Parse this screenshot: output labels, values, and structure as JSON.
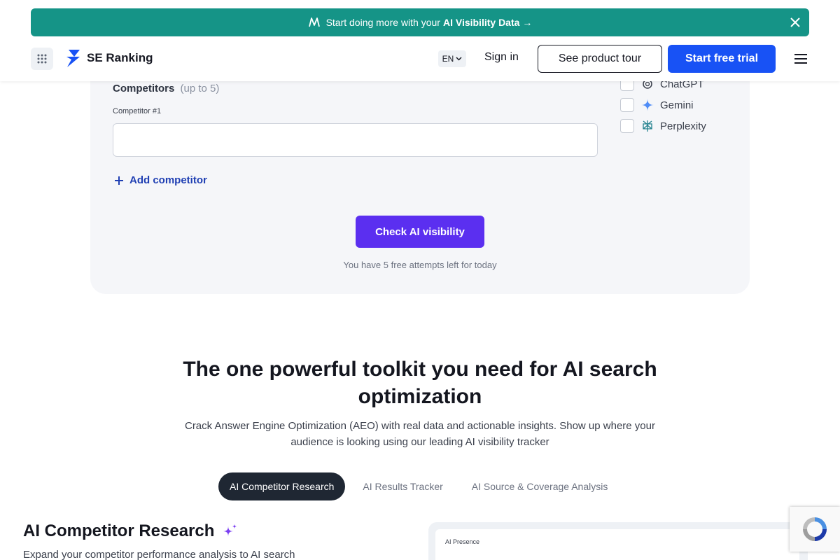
{
  "banner": {
    "text": "Start doing more with your",
    "bold": "AI Visibility Data",
    "arrow": "→",
    "icon": "ai-logo-icon",
    "color": "#159487"
  },
  "header": {
    "logo_text": "SE Ranking",
    "lang": "EN",
    "sign_in": "Sign in",
    "tour_label": "See product tour",
    "trial_label": "Start free trial",
    "accent": "#1852f5"
  },
  "form": {
    "competitors_title": "Competitors",
    "competitors_hint": "(up to 5)",
    "competitor_label": "Competitor #1",
    "competitor_value": "",
    "add_label": "Add competitor",
    "check_label": "Check AI visibility",
    "attempts": "You have 5 free attempts left for today",
    "engines": [
      {
        "label": "ChatGPT",
        "checked": false,
        "icon": "chatgpt-icon"
      },
      {
        "label": "Gemini",
        "checked": false,
        "icon": "gemini-icon"
      },
      {
        "label": "Perplexity",
        "checked": false,
        "icon": "perplexity-icon"
      }
    ]
  },
  "section": {
    "headline_1": "The one powerful toolkit you need for AI search",
    "headline_2": "optimization",
    "sub_1": "Crack Answer Engine Optimization (AEO) with real data and actionable insights. Show up where your",
    "sub_2": "audience is looking using our leading AI visibility tracker",
    "tabs": [
      {
        "label": "AI Competitor Research",
        "active": true
      },
      {
        "label": "AI Results Tracker",
        "active": false
      },
      {
        "label": "AI Source & Coverage Analysis",
        "active": false
      }
    ],
    "res_title": "AI Competitor Research",
    "res_desc": "Expand your competitor performance analysis to AI search",
    "preview_label": "AI Presence"
  }
}
